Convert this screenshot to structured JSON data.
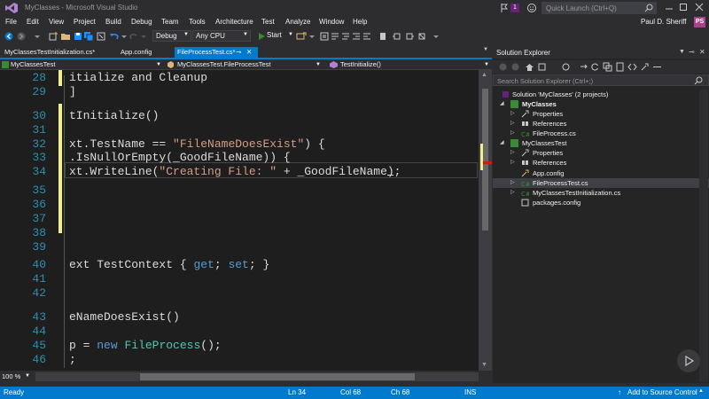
{
  "window": {
    "title": "MyClasses - Microsoft Visual Studio",
    "notification_count": "1",
    "quick_launch_placeholder": "Quick Launch (Ctrl+Q)"
  },
  "menu": [
    "File",
    "Edit",
    "View",
    "Project",
    "Build",
    "Debug",
    "Team",
    "Tools",
    "Architecture",
    "Test",
    "Analyze",
    "Window",
    "Help"
  ],
  "user": {
    "name": "Paul D. Sheriff",
    "initials": "PS"
  },
  "toolbar": {
    "config": "Debug",
    "platform": "Any CPU",
    "start_label": "Start"
  },
  "tabs": [
    {
      "label": "MyClassesTestInitialization.cs*",
      "active": false
    },
    {
      "label": "App.config",
      "active": false
    },
    {
      "label": "FileProcessTest.cs*",
      "active": true
    }
  ],
  "nav": {
    "project": "MyClassesTest",
    "class": "MyClassesTest.FileProcessTest",
    "member": "TestInitialize()"
  },
  "editor": {
    "zoom": "100 %",
    "lines": [
      {
        "num": "28",
        "text": "itialize and Cleanup"
      },
      {
        "num": "29",
        "text": "]"
      },
      {
        "num": "30",
        "text": "tInitialize()"
      },
      {
        "num": "31",
        "text": ""
      },
      {
        "num": "32",
        "text": "xt.TestName == \"FileNameDoesExist\") {"
      },
      {
        "num": "33",
        "text": ".IsNullOrEmpty(_GoodFileName)) {"
      },
      {
        "num": "34",
        "text": "xt.WriteLine(\"Creating File: \" + _GoodFileName);"
      },
      {
        "num": "35",
        "text": ""
      },
      {
        "num": "36",
        "text": ""
      },
      {
        "num": "37",
        "text": ""
      },
      {
        "num": "38",
        "text": ""
      },
      {
        "num": "39",
        "text": ""
      },
      {
        "num": "40",
        "text": "ext TestContext { get; set; }"
      },
      {
        "num": "41",
        "text": ""
      },
      {
        "num": "42",
        "text": ""
      },
      {
        "num": "43",
        "text": "eNameDoesExist()"
      },
      {
        "num": "44",
        "text": ""
      },
      {
        "num": "45",
        "text": "p = new FileProcess();"
      },
      {
        "num": "46",
        "text": ";"
      }
    ]
  },
  "solution_explorer": {
    "title": "Solution Explorer",
    "search_placeholder": "Search Solution Explorer (Ctrl+;)",
    "solution": "Solution 'MyClasses' (2 projects)",
    "projects": [
      {
        "name": "MyClasses",
        "items": [
          "Properties",
          "References",
          "FileProcess.cs"
        ]
      },
      {
        "name": "MyClassesTest",
        "items": [
          "Properties",
          "References",
          "App.config",
          "FileProcessTest.cs",
          "MyClassesTestInitialization.cs",
          "packages.config"
        ]
      }
    ]
  },
  "status": {
    "state": "Ready",
    "ln": "Ln 34",
    "col": "Col 68",
    "ch": "Ch 68",
    "mode": "INS",
    "source_control": "Add to Source Control"
  },
  "colors": {
    "accent": "#007acc",
    "keyword": "#569cd6",
    "string": "#d69d85",
    "type": "#4ec9b0",
    "line_number": "#2b91af"
  }
}
